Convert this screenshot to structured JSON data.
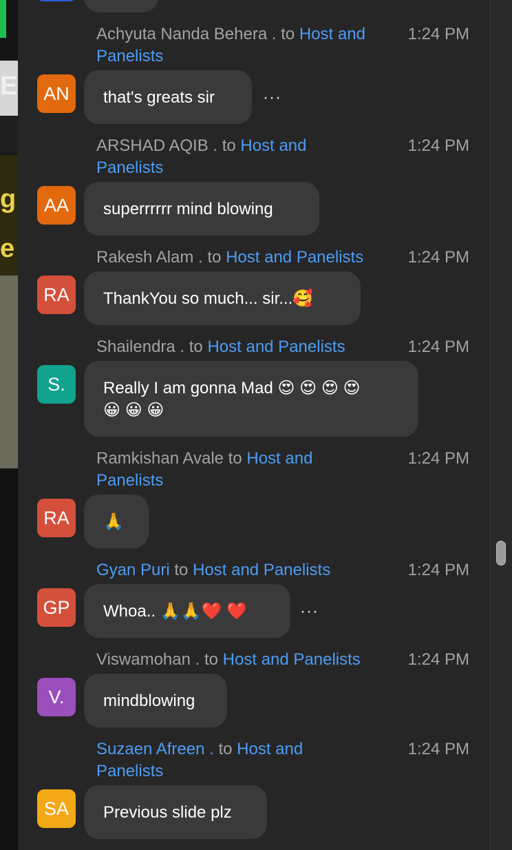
{
  "video": {
    "glyphs": [
      "E",
      "g",
      "e"
    ]
  },
  "messages": [
    {
      "sender": "Achyuta Nanda Behera .",
      "to_word": "to",
      "recipient_line1": "Host and",
      "recipient_line2": "Panelists",
      "time": "1:24 PM",
      "avatar": "AN",
      "avatar_color": "#e2690e",
      "text": "that's greats sir",
      "more": "···"
    },
    {
      "sender": "ARSHAD AQIB .",
      "to_word": "to",
      "recipient_line1": "Host and",
      "recipient_line2": "Panelists",
      "time": "1:24 PM",
      "avatar": "AA",
      "avatar_color": "#e2690e",
      "text": "superrrrrr mind blowing"
    },
    {
      "sender": "Rakesh Alam .",
      "to_word": "to",
      "recipient": "Host and Panelists",
      "time": "1:24 PM",
      "avatar": "RA",
      "avatar_color": "#d4503b",
      "text": "ThankYou so much... sir...🥰"
    },
    {
      "sender": "Shailendra .",
      "to_word": "to",
      "recipient": "Host and Panelists",
      "time": "1:24 PM",
      "avatar": "S.",
      "avatar_color": "#11a38e",
      "text_line1": "Really I am gonna Mad 😍 😍 😍 😍",
      "text_line2": "😀 😀 😀"
    },
    {
      "sender": "Ramkishan Avale",
      "to_word": "to",
      "recipient_line1": "Host and",
      "recipient_line2": "Panelists",
      "time": "1:24 PM",
      "avatar": "RA",
      "avatar_color": "#d4503b",
      "text": "🙏"
    },
    {
      "sender": "Gyan Puri",
      "to_word": "to",
      "recipient": "Host and Panelists",
      "time": "1:24 PM",
      "avatar": "GP",
      "avatar_color": "#d4503b",
      "text": "Whoa.. 🙏🙏❤️ ❤️",
      "more": "···"
    },
    {
      "sender": "Viswamohan .",
      "to_word": "to",
      "recipient": "Host and Panelists",
      "time": "1:24 PM",
      "avatar": "V.",
      "avatar_color": "#9a4fbd",
      "text": "mindblowing"
    },
    {
      "sender": "Suzaen Afreen .",
      "to_word": "to",
      "recipient_line1": "Host and",
      "recipient_line2": "Panelists",
      "time": "1:24 PM",
      "avatar": "SA",
      "avatar_color": "#f3a915",
      "text": "Previous slide plz"
    }
  ]
}
